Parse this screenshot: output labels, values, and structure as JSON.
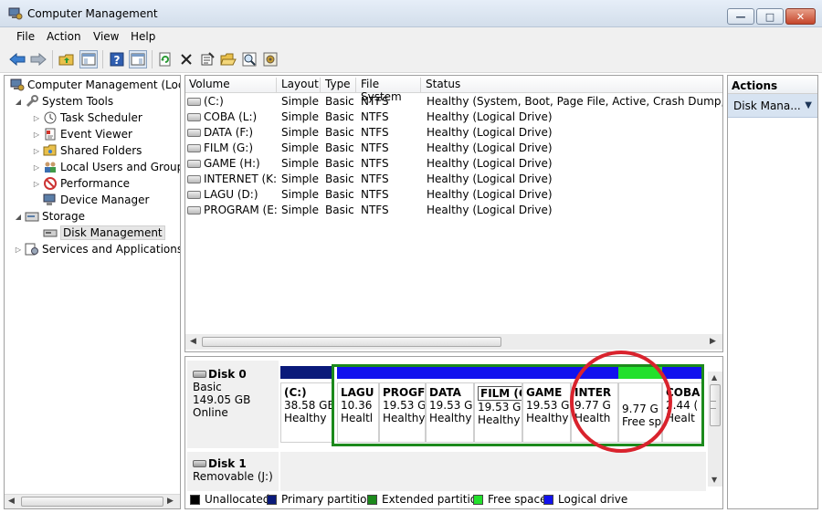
{
  "window": {
    "title": "Computer Management"
  },
  "menu": [
    "File",
    "Action",
    "View",
    "Help"
  ],
  "tree": {
    "root": "Computer Management (Local",
    "items": [
      {
        "label": "System Tools",
        "level": 1,
        "icon": "tools-icon"
      },
      {
        "label": "Task Scheduler",
        "level": 2,
        "icon": "clock-icon"
      },
      {
        "label": "Event Viewer",
        "level": 2,
        "icon": "event-viewer-icon"
      },
      {
        "label": "Shared Folders",
        "level": 2,
        "icon": "shared-folder-icon"
      },
      {
        "label": "Local Users and Groups",
        "level": 2,
        "icon": "users-icon"
      },
      {
        "label": "Performance",
        "level": 2,
        "icon": "performance-icon"
      },
      {
        "label": "Device Manager",
        "level": 2,
        "icon": "device-manager-icon"
      },
      {
        "label": "Storage",
        "level": 1,
        "icon": "storage-icon"
      },
      {
        "label": "Disk Management",
        "level": 2,
        "icon": "disk-management-icon"
      },
      {
        "label": "Services and Applications",
        "level": 1,
        "icon": "services-icon"
      }
    ]
  },
  "volumes": {
    "headers": {
      "volume": "Volume",
      "layout": "Layout",
      "type": "Type",
      "fs": "File System",
      "status": "Status"
    },
    "rows": [
      {
        "volume": "(C:)",
        "layout": "Simple",
        "type": "Basic",
        "fs": "NTFS",
        "status": "Healthy (System, Boot, Page File, Active, Crash Dump, Primar"
      },
      {
        "volume": "COBA (L:)",
        "layout": "Simple",
        "type": "Basic",
        "fs": "NTFS",
        "status": "Healthy (Logical Drive)"
      },
      {
        "volume": "DATA (F:)",
        "layout": "Simple",
        "type": "Basic",
        "fs": "NTFS",
        "status": "Healthy (Logical Drive)"
      },
      {
        "volume": "FILM (G:)",
        "layout": "Simple",
        "type": "Basic",
        "fs": "NTFS",
        "status": "Healthy (Logical Drive)"
      },
      {
        "volume": "GAME (H:)",
        "layout": "Simple",
        "type": "Basic",
        "fs": "NTFS",
        "status": "Healthy (Logical Drive)"
      },
      {
        "volume": "INTERNET (K:)",
        "layout": "Simple",
        "type": "Basic",
        "fs": "NTFS",
        "status": "Healthy (Logical Drive)"
      },
      {
        "volume": "LAGU (D:)",
        "layout": "Simple",
        "type": "Basic",
        "fs": "NTFS",
        "status": "Healthy (Logical Drive)"
      },
      {
        "volume": "PROGRAM (E:)",
        "layout": "Simple",
        "type": "Basic",
        "fs": "NTFS",
        "status": "Healthy (Logical Drive)"
      }
    ]
  },
  "disk0": {
    "name": "Disk 0",
    "type": "Basic",
    "size": "149.05 GB",
    "state": "Online",
    "partitions": [
      {
        "name": "(C:)",
        "size": "38.58 GE",
        "status": "Healthy",
        "bar": "primary"
      },
      {
        "name": "LAGU",
        "size": "10.36",
        "status": "Healtl",
        "bar": "logical"
      },
      {
        "name": "PROGF",
        "size": "19.53 G",
        "status": "Healthy",
        "bar": "logical"
      },
      {
        "name": "DATA",
        "size": "19.53 G",
        "status": "Healthy",
        "bar": "logical"
      },
      {
        "name": "FILM (G:",
        "size": "19.53 G",
        "status": "Healthy",
        "bar": "logical",
        "boxed": true
      },
      {
        "name": "GAME",
        "size": "19.53 G",
        "status": "Healthy",
        "bar": "logical"
      },
      {
        "name": "INTER",
        "size": "9.77 G",
        "status": "Health",
        "bar": "logical"
      },
      {
        "name": "",
        "size": "9.77 G",
        "status": "Free sp",
        "bar": "free"
      },
      {
        "name": "COBA",
        "size": "2.44 (",
        "status": "Healt",
        "bar": "logical"
      }
    ]
  },
  "disk1": {
    "name": "Disk 1",
    "type": "Removable (J:)"
  },
  "legend": [
    {
      "label": "Unallocated",
      "color": "#000000"
    },
    {
      "label": "Primary partition",
      "color": "#0a1a7a"
    },
    {
      "label": "Extended partition",
      "color": "#1c8a1c"
    },
    {
      "label": "Free space",
      "color": "#22e02c"
    },
    {
      "label": "Logical drive",
      "color": "#1212ee"
    }
  ],
  "actions": {
    "header": "Actions",
    "sub": "Disk Mana..."
  },
  "colors": {
    "primary": "#0a1a7a",
    "logical": "#1212ee",
    "free": "#22e02c",
    "extended": "#1c8a1c",
    "highlight": "#d9232d"
  }
}
